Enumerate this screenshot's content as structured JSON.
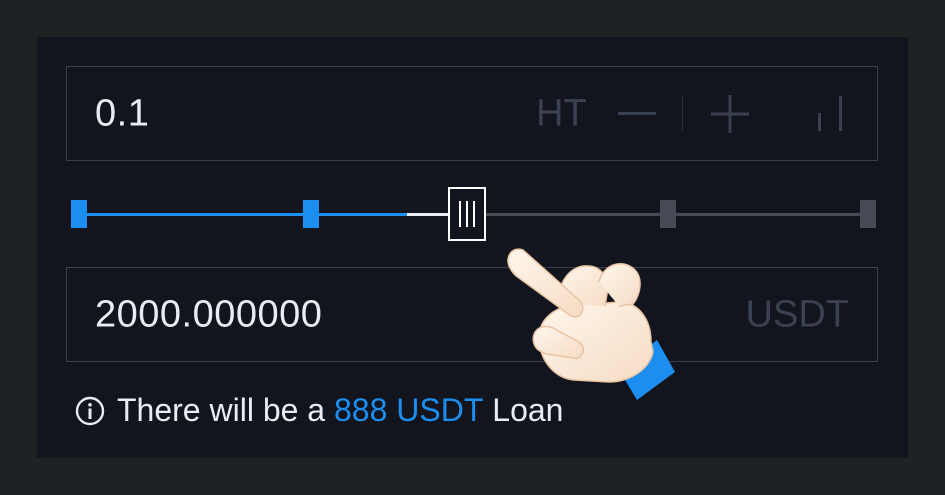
{
  "order_form": {
    "amount": {
      "value": "0.1",
      "unit": "HT",
      "minus_icon": "minus-icon",
      "plus_icon": "plus-icon",
      "depth_icon": "bars-icon"
    },
    "slider": {
      "position_fraction": 0.5,
      "nodes": 5,
      "accent": "#1b8ef0",
      "inactive": "#464b56"
    },
    "total": {
      "value": "2000.000000",
      "unit": "USDT"
    },
    "loan_notice": {
      "prefix": "There will be a",
      "highlight": "888 USDT",
      "suffix": "Loan",
      "icon": "info-icon"
    }
  },
  "colors": {
    "background": "#1d2224",
    "panel": "#12151d",
    "accent": "#1b8ef0",
    "text": "#e9edf2",
    "muted": "#3a4150"
  }
}
